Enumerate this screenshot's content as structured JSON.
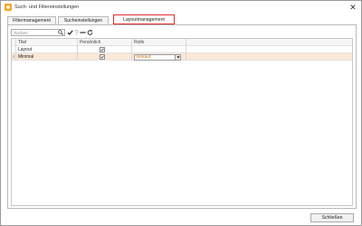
{
  "window": {
    "title": "Such- und Filtereinstellungen",
    "close_symbol": "✕"
  },
  "tabs": [
    {
      "label": "Filtermanagement",
      "active": false
    },
    {
      "label": "Sucheinstellungen",
      "active": false
    },
    {
      "label": "Layoutmanagement",
      "active": true
    }
  ],
  "toolbar": {
    "search_placeholder": "Suchen",
    "icons": [
      "search-icon",
      "apply-check-icon",
      "help-icon",
      "remove-icon",
      "refresh-icon"
    ]
  },
  "grid": {
    "columns": [
      "",
      "Titel",
      "Persönlich",
      "Rolle"
    ],
    "group_row": {
      "title": "Layout",
      "personal": true,
      "role": ""
    },
    "rows": [
      {
        "marker": "I",
        "title": "Minimal",
        "personal": true,
        "role": "Verkauf"
      }
    ]
  },
  "footer": {
    "close_label": "Schließen"
  },
  "colors": {
    "accent_red": "#e03030",
    "selected_row": "#fbe8d7",
    "role_text": "#d26a00"
  }
}
